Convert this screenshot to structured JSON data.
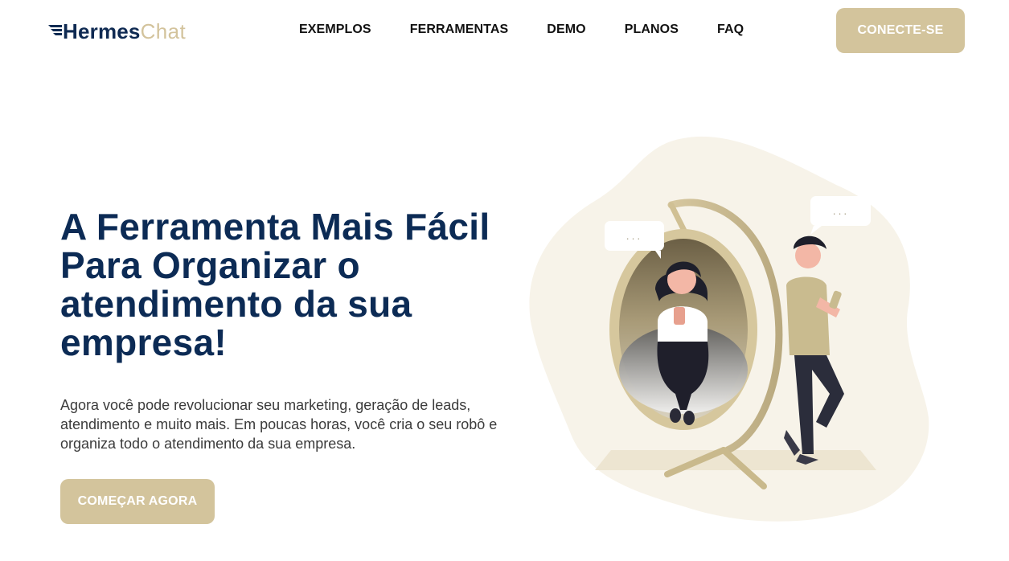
{
  "brand": {
    "name_part1": "Hermes",
    "name_part2": "Chat",
    "primary_color": "#0c2b55",
    "accent_color": "#d3c49c"
  },
  "nav": {
    "items": [
      {
        "label": "EXEMPLOS"
      },
      {
        "label": "FERRAMENTAS"
      },
      {
        "label": "DEMO"
      },
      {
        "label": "PLANOS"
      },
      {
        "label": "FAQ"
      }
    ],
    "cta_label": "CONECTE-SE"
  },
  "hero": {
    "title": "A Ferramenta Mais Fácil Para Organizar o atendimento da sua empresa!",
    "subtitle": "Agora você pode revolucionar seu marketing, geração de leads, atendimento e muito mais. Em poucas horas, você cria o seu robô e organiza todo o atendimento da sua empresa.",
    "cta_label": "COMEÇAR AGORA"
  },
  "illustration": {
    "bubble_left": "...",
    "bubble_right": "..."
  }
}
